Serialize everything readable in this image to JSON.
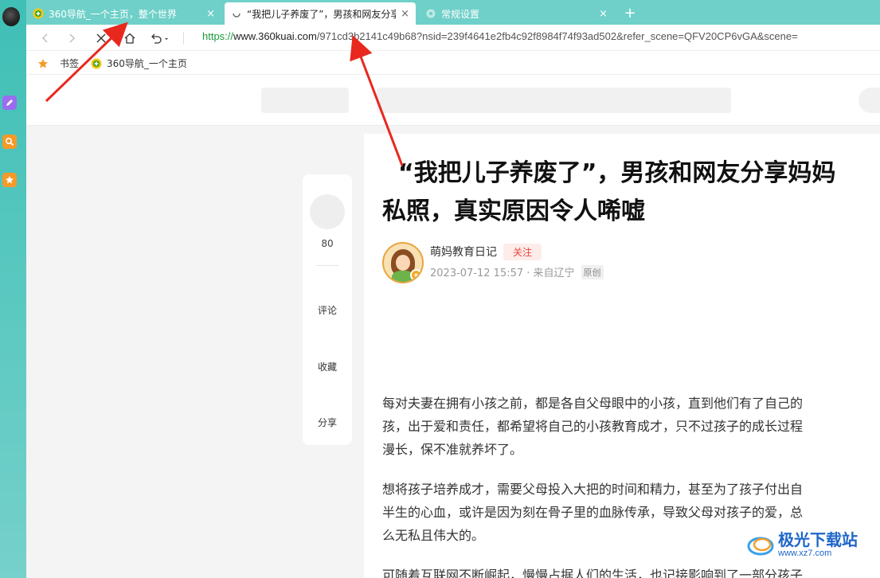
{
  "tabs": [
    {
      "title": "360导航_一个主页，整个世界",
      "close": "×"
    },
    {
      "title": "“我把儿子养废了”，男孩和网友分享",
      "close": "×"
    },
    {
      "title": "常规设置",
      "close": "×"
    }
  ],
  "new_tab": "+",
  "address": {
    "scheme": "https://",
    "host": "www.360kuai.com",
    "path": "/971cd3b2141c49b68?nsid=239f4641e2fb4c92f8984f74f93ad502&refer_scene=QFV20CP6vGA&scene="
  },
  "bookmarks": [
    {
      "label": "书签"
    },
    {
      "label": "360导航_一个主页"
    }
  ],
  "rail": {
    "count": "80",
    "comment": "评论",
    "favorite": "收藏",
    "share": "分享"
  },
  "article": {
    "title_line1": "“我把儿子养废了”，男孩和网友分享妈妈",
    "title_line2": "私照，真实原因令人唏嘘",
    "author": "萌妈教育日记",
    "follow": "关注",
    "meta": "2023-07-12 15:57 · 来自辽宁",
    "original": "原创",
    "paragraphs": [
      [
        "每对夫妻在拥有小孩之前，都是各自父母眼中的小孩，直到他们有了自己的",
        "孩，出于爱和责任，都希望将自己的小孩教育成才，只不过孩子的成长过程",
        "漫长，保不准就养坏了。"
      ],
      [
        "想将孩子培养成才，需要父母投入大把的时间和精力，甚至为了孩子付出自",
        "半生的心血，或许是因为刻在骨子里的血脉传承，导致父母对孩子的爱，总",
        "么无私且伟大的。"
      ],
      [
        "可随着互联网不断崛起，慢慢占据人们的生活，也记接影响到了一部分孩子"
      ]
    ]
  },
  "watermark": {
    "name": "极光下载站",
    "url": "www.xz7.com"
  },
  "colors": {
    "sidebar": "#4cc5bc",
    "tabstrip": "#6fd0c9",
    "annotation": "#e8281e",
    "url_scheme": "#1a9a3a"
  }
}
